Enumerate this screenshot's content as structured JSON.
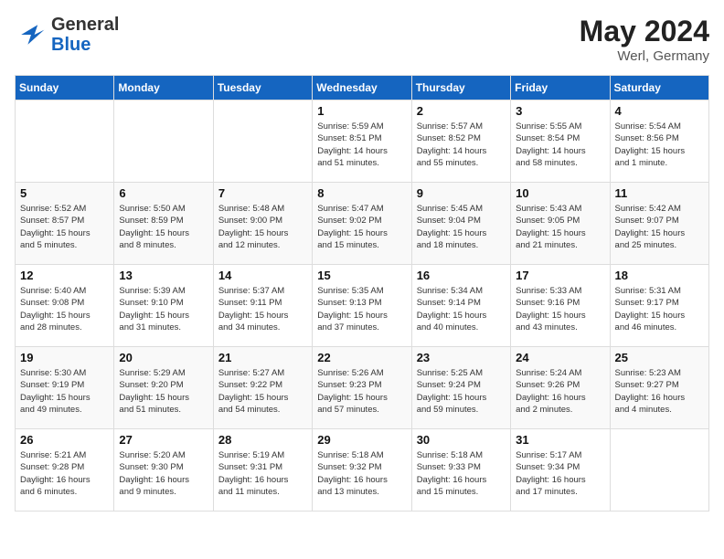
{
  "header": {
    "logo_general": "General",
    "logo_blue": "Blue",
    "month_year": "May 2024",
    "location": "Werl, Germany"
  },
  "days_of_week": [
    "Sunday",
    "Monday",
    "Tuesday",
    "Wednesday",
    "Thursday",
    "Friday",
    "Saturday"
  ],
  "weeks": [
    [
      {
        "day": "",
        "info": ""
      },
      {
        "day": "",
        "info": ""
      },
      {
        "day": "",
        "info": ""
      },
      {
        "day": "1",
        "info": "Sunrise: 5:59 AM\nSunset: 8:51 PM\nDaylight: 14 hours\nand 51 minutes."
      },
      {
        "day": "2",
        "info": "Sunrise: 5:57 AM\nSunset: 8:52 PM\nDaylight: 14 hours\nand 55 minutes."
      },
      {
        "day": "3",
        "info": "Sunrise: 5:55 AM\nSunset: 8:54 PM\nDaylight: 14 hours\nand 58 minutes."
      },
      {
        "day": "4",
        "info": "Sunrise: 5:54 AM\nSunset: 8:56 PM\nDaylight: 15 hours\nand 1 minute."
      }
    ],
    [
      {
        "day": "5",
        "info": "Sunrise: 5:52 AM\nSunset: 8:57 PM\nDaylight: 15 hours\nand 5 minutes."
      },
      {
        "day": "6",
        "info": "Sunrise: 5:50 AM\nSunset: 8:59 PM\nDaylight: 15 hours\nand 8 minutes."
      },
      {
        "day": "7",
        "info": "Sunrise: 5:48 AM\nSunset: 9:00 PM\nDaylight: 15 hours\nand 12 minutes."
      },
      {
        "day": "8",
        "info": "Sunrise: 5:47 AM\nSunset: 9:02 PM\nDaylight: 15 hours\nand 15 minutes."
      },
      {
        "day": "9",
        "info": "Sunrise: 5:45 AM\nSunset: 9:04 PM\nDaylight: 15 hours\nand 18 minutes."
      },
      {
        "day": "10",
        "info": "Sunrise: 5:43 AM\nSunset: 9:05 PM\nDaylight: 15 hours\nand 21 minutes."
      },
      {
        "day": "11",
        "info": "Sunrise: 5:42 AM\nSunset: 9:07 PM\nDaylight: 15 hours\nand 25 minutes."
      }
    ],
    [
      {
        "day": "12",
        "info": "Sunrise: 5:40 AM\nSunset: 9:08 PM\nDaylight: 15 hours\nand 28 minutes."
      },
      {
        "day": "13",
        "info": "Sunrise: 5:39 AM\nSunset: 9:10 PM\nDaylight: 15 hours\nand 31 minutes."
      },
      {
        "day": "14",
        "info": "Sunrise: 5:37 AM\nSunset: 9:11 PM\nDaylight: 15 hours\nand 34 minutes."
      },
      {
        "day": "15",
        "info": "Sunrise: 5:35 AM\nSunset: 9:13 PM\nDaylight: 15 hours\nand 37 minutes."
      },
      {
        "day": "16",
        "info": "Sunrise: 5:34 AM\nSunset: 9:14 PM\nDaylight: 15 hours\nand 40 minutes."
      },
      {
        "day": "17",
        "info": "Sunrise: 5:33 AM\nSunset: 9:16 PM\nDaylight: 15 hours\nand 43 minutes."
      },
      {
        "day": "18",
        "info": "Sunrise: 5:31 AM\nSunset: 9:17 PM\nDaylight: 15 hours\nand 46 minutes."
      }
    ],
    [
      {
        "day": "19",
        "info": "Sunrise: 5:30 AM\nSunset: 9:19 PM\nDaylight: 15 hours\nand 49 minutes."
      },
      {
        "day": "20",
        "info": "Sunrise: 5:29 AM\nSunset: 9:20 PM\nDaylight: 15 hours\nand 51 minutes."
      },
      {
        "day": "21",
        "info": "Sunrise: 5:27 AM\nSunset: 9:22 PM\nDaylight: 15 hours\nand 54 minutes."
      },
      {
        "day": "22",
        "info": "Sunrise: 5:26 AM\nSunset: 9:23 PM\nDaylight: 15 hours\nand 57 minutes."
      },
      {
        "day": "23",
        "info": "Sunrise: 5:25 AM\nSunset: 9:24 PM\nDaylight: 15 hours\nand 59 minutes."
      },
      {
        "day": "24",
        "info": "Sunrise: 5:24 AM\nSunset: 9:26 PM\nDaylight: 16 hours\nand 2 minutes."
      },
      {
        "day": "25",
        "info": "Sunrise: 5:23 AM\nSunset: 9:27 PM\nDaylight: 16 hours\nand 4 minutes."
      }
    ],
    [
      {
        "day": "26",
        "info": "Sunrise: 5:21 AM\nSunset: 9:28 PM\nDaylight: 16 hours\nand 6 minutes."
      },
      {
        "day": "27",
        "info": "Sunrise: 5:20 AM\nSunset: 9:30 PM\nDaylight: 16 hours\nand 9 minutes."
      },
      {
        "day": "28",
        "info": "Sunrise: 5:19 AM\nSunset: 9:31 PM\nDaylight: 16 hours\nand 11 minutes."
      },
      {
        "day": "29",
        "info": "Sunrise: 5:18 AM\nSunset: 9:32 PM\nDaylight: 16 hours\nand 13 minutes."
      },
      {
        "day": "30",
        "info": "Sunrise: 5:18 AM\nSunset: 9:33 PM\nDaylight: 16 hours\nand 15 minutes."
      },
      {
        "day": "31",
        "info": "Sunrise: 5:17 AM\nSunset: 9:34 PM\nDaylight: 16 hours\nand 17 minutes."
      },
      {
        "day": "",
        "info": ""
      }
    ]
  ]
}
